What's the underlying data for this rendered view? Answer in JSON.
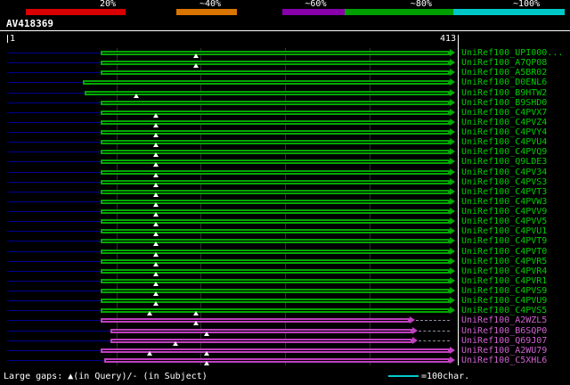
{
  "query": {
    "name": "AV418369",
    "start_label": "1",
    "end_label": "413"
  },
  "scale": {
    "segments": [
      {
        "color": "#000000",
        "width_pct": 4.5
      },
      {
        "color": "#D80000",
        "width_pct": 17.5
      },
      {
        "color": "#000000",
        "width_pct": 9
      },
      {
        "color": "#D87400",
        "width_pct": 10.5
      },
      {
        "color": "#000000",
        "width_pct": 8
      },
      {
        "color": "#8800AA",
        "width_pct": 11
      },
      {
        "color": "#00A000",
        "width_pct": 19
      },
      {
        "color": "#00C8C8",
        "width_pct": 19.5
      },
      {
        "color": "#000000",
        "width_pct": 1
      }
    ],
    "labels": [
      {
        "text": "20%",
        "left_pct": 17.5
      },
      {
        "text": "~40%",
        "left_pct": 35.0
      },
      {
        "text": "~60%",
        "left_pct": 53.5
      },
      {
        "text": "~80%",
        "left_pct": 72.0
      },
      {
        "text": "~100%",
        "left_pct": 90.0
      }
    ]
  },
  "colors": {
    "green_bar": "#00A800",
    "green_label": "#00CC00",
    "magenta_bar": "#C040C0",
    "magenta_label": "#D060D0",
    "leader": "#000090",
    "gap_marker": "#FFFFFF",
    "tail": "#9090A0",
    "cyan": "#00CCCC"
  },
  "legend": {
    "gaps_text": "Large gaps: ▲(in Query)/- (in Subject)",
    "scale_unit_text": "=100char."
  },
  "chart_data": {
    "type": "bar",
    "orientation": "horizontal",
    "title": "AV418369",
    "x_range": [
      1,
      413
    ],
    "rows": [
      {
        "label": "UniRef100_UPI000...",
        "color": "green",
        "start": 86,
        "end": 406,
        "gaps": [
          173
        ]
      },
      {
        "label": "UniRef100_A7QP08",
        "color": "green",
        "start": 86,
        "end": 406,
        "gaps": [
          173
        ]
      },
      {
        "label": "UniRef100_A5BR02",
        "color": "green",
        "start": 86,
        "end": 406,
        "gaps": []
      },
      {
        "label": "UniRef100_D0ENL6",
        "color": "green",
        "start": 69,
        "end": 406,
        "gaps": []
      },
      {
        "label": "UniRef100_B9HTW2",
        "color": "green",
        "start": 71,
        "end": 406,
        "gaps": [
          118
        ]
      },
      {
        "label": "UniRef100_B9SHD0",
        "color": "green",
        "start": 86,
        "end": 406,
        "gaps": []
      },
      {
        "label": "UniRef100_C4PVX7",
        "color": "green",
        "start": 86,
        "end": 406,
        "gaps": [
          136
        ]
      },
      {
        "label": "UniRef100_C4PVZ4",
        "color": "green",
        "start": 86,
        "end": 406,
        "gaps": [
          136
        ]
      },
      {
        "label": "UniRef100_C4PVY4",
        "color": "green",
        "start": 86,
        "end": 406,
        "gaps": [
          136
        ]
      },
      {
        "label": "UniRef100_C4PVU4",
        "color": "green",
        "start": 86,
        "end": 406,
        "gaps": [
          136
        ]
      },
      {
        "label": "UniRef100_C4PVQ9",
        "color": "green",
        "start": 86,
        "end": 406,
        "gaps": [
          136
        ]
      },
      {
        "label": "UniRef100_Q9LDE3",
        "color": "green",
        "start": 86,
        "end": 406,
        "gaps": [
          136
        ]
      },
      {
        "label": "UniRef100_C4PV34",
        "color": "green",
        "start": 86,
        "end": 406,
        "gaps": [
          136
        ]
      },
      {
        "label": "UniRef100_C4PVS3",
        "color": "green",
        "start": 86,
        "end": 406,
        "gaps": [
          136
        ]
      },
      {
        "label": "UniRef100_C4PVT3",
        "color": "green",
        "start": 86,
        "end": 406,
        "gaps": [
          136
        ]
      },
      {
        "label": "UniRef100_C4PVW3",
        "color": "green",
        "start": 86,
        "end": 406,
        "gaps": [
          136
        ]
      },
      {
        "label": "UniRef100_C4PVV9",
        "color": "green",
        "start": 86,
        "end": 406,
        "gaps": [
          136
        ]
      },
      {
        "label": "UniRef100_C4PVV5",
        "color": "green",
        "start": 86,
        "end": 406,
        "gaps": [
          136
        ]
      },
      {
        "label": "UniRef100_C4PVU1",
        "color": "green",
        "start": 86,
        "end": 406,
        "gaps": [
          136
        ]
      },
      {
        "label": "UniRef100_C4PVT9",
        "color": "green",
        "start": 86,
        "end": 406,
        "gaps": [
          136
        ]
      },
      {
        "label": "UniRef100_C4PVT0",
        "color": "green",
        "start": 86,
        "end": 406,
        "gaps": [
          136
        ]
      },
      {
        "label": "UniRef100_C4PVR5",
        "color": "green",
        "start": 86,
        "end": 406,
        "gaps": [
          136
        ]
      },
      {
        "label": "UniRef100_C4PVR4",
        "color": "green",
        "start": 86,
        "end": 406,
        "gaps": [
          136
        ]
      },
      {
        "label": "UniRef100_C4PVR1",
        "color": "green",
        "start": 86,
        "end": 406,
        "gaps": [
          136
        ]
      },
      {
        "label": "UniRef100_C4PVS9",
        "color": "green",
        "start": 86,
        "end": 406,
        "gaps": [
          136
        ]
      },
      {
        "label": "UniRef100_C4PVU9",
        "color": "green",
        "start": 86,
        "end": 406,
        "gaps": [
          136
        ]
      },
      {
        "label": "UniRef100_C4PVS5",
        "color": "green",
        "start": 86,
        "end": 406,
        "gaps": [
          131,
          173
        ]
      },
      {
        "label": "UniRef100_A2WZL5",
        "color": "magenta",
        "start": 86,
        "end": 369,
        "gaps": [
          173
        ],
        "tail_end": 406
      },
      {
        "label": "UniRef100_B6SQP0",
        "color": "magenta",
        "start": 95,
        "end": 371,
        "gaps": [
          183
        ],
        "tail_end": 406
      },
      {
        "label": "UniRef100_Q69J07",
        "color": "magenta",
        "start": 95,
        "end": 371,
        "gaps": [
          154
        ],
        "tail_end": 406
      },
      {
        "label": "UniRef100_A2WU79",
        "color": "magenta",
        "start": 86,
        "end": 406,
        "gaps": [
          131,
          183
        ]
      },
      {
        "label": "UniRef100_C5XHL6",
        "color": "magenta",
        "start": 89,
        "end": 406,
        "gaps": [
          183
        ]
      }
    ]
  }
}
